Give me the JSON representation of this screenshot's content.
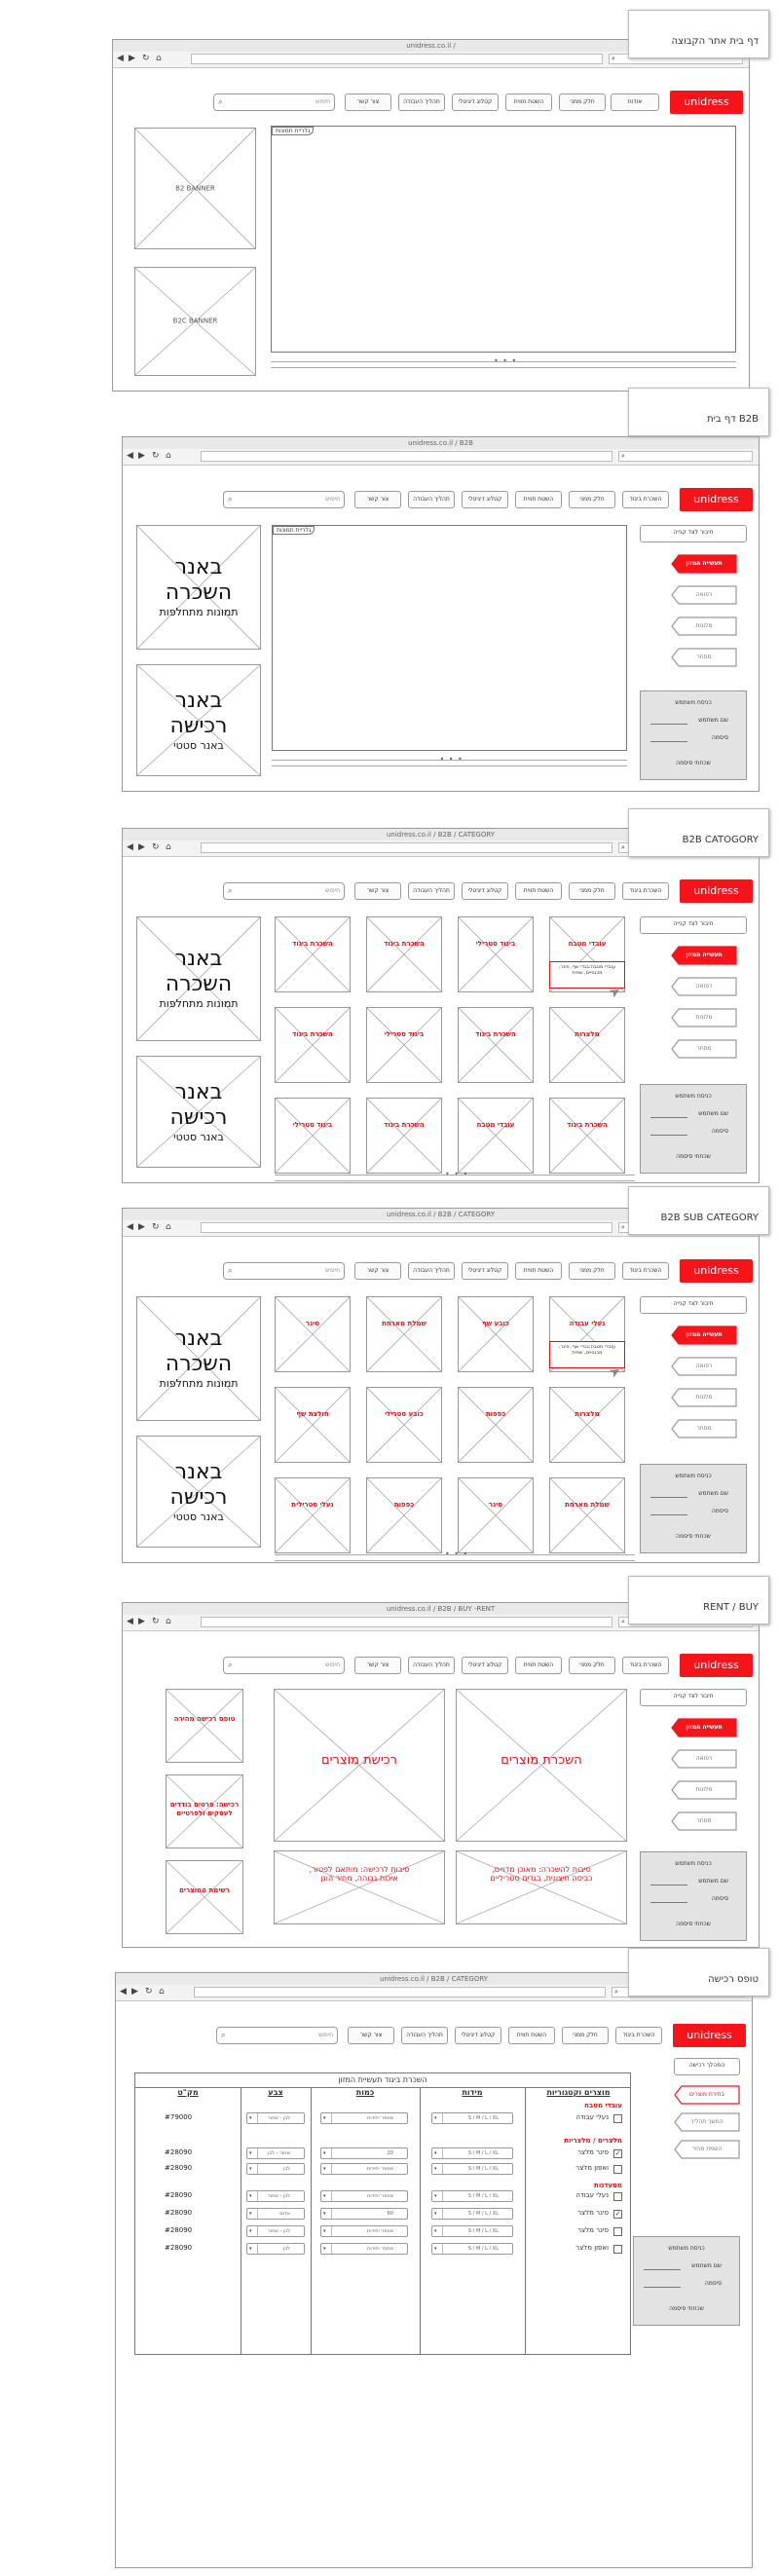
{
  "brand": {
    "logo": "unidress",
    "accent": "#f5141a"
  },
  "common": {
    "menu": {
      "rental": "השכרת ביגוד",
      "about": "אודות",
      "our_clients": "חלק ממני",
      "wash_tags": "השטת תווית",
      "catalog": "קטלוג דיגיטלי",
      "process": "תהליך העבודה",
      "contact": "צור קשר"
    },
    "site_search": "חיפוש",
    "b2b_login": "חיבור לצד קנייה",
    "industries": {
      "active": "תעשייה המזון",
      "medical": "רפואה",
      "hotels": "מלונות",
      "retail": "מסחר"
    },
    "login_box": {
      "title": "כניסת משתמש",
      "username": "שם משתמש",
      "password": "סיסמה",
      "forgot": "שכחתי סיסמה"
    },
    "banner_rent": {
      "line1": "באנר",
      "line2": "השכרה",
      "line3": "תמונות מתחלפות"
    },
    "banner_buy": {
      "line1": "באנר",
      "line2": "רכישה",
      "line3": "באנר סטטי"
    }
  },
  "screens": [
    {
      "note": "דף בית אתר הקבוצה",
      "url": "unidress.co.il /",
      "carousel_tag": "גלריית תמונות",
      "b2b_banner": "B2 BANNER",
      "b2c_banner": "B2C BANNER"
    },
    {
      "note": "דף בית B2B",
      "url": "unidress.co.il / B2B",
      "carousel_tag": "גלריית תמונות"
    },
    {
      "note": "B2B CATOGORY",
      "url": "unidress.co.il / B2B / CATEGORY",
      "tiles": [
        "עובדי מטבח",
        "ביגוד סטרילי",
        "השכרת ביגוד",
        "השכרת ביגוד",
        "מלצרות",
        "השכרת ביגוד",
        "ביגוד סטרילי",
        "השכרת ביגוד",
        "השכרת ביגוד",
        "עובדי מטבח",
        "השכרת ביגוד",
        "ביגוד סטרילי"
      ],
      "tooltip": "עובדי מטבח:בגדי שף, סינר, מכנסיים, שפית"
    },
    {
      "note": "B2B SUB CATEGORY",
      "url": "unidress.co.il / B2B / CATEGORY",
      "tiles": [
        "נעלי עבודה",
        "כובע שף",
        "שמלת מארחת",
        "סינר",
        "מלצרות",
        "כפפות",
        "כובע סטרילי",
        "חולצת שף",
        "שמלת מארחת",
        "סינר",
        "כפפות",
        "נעלי סטרילית"
      ],
      "tooltip": "עובדי מטבח:בגדי שף, סינר, מכנסיים, שפית"
    },
    {
      "note": "RENT / BUY",
      "url": "unidress.co.il / B2B / BUY -RENT",
      "rent_tile": "השכרת מוצרים",
      "buy_tile": "רכישת מוצרים",
      "rent_info": "סיבות להשכרה: מאוכן מדויים, כביסה חיצונית, בגדים סטריליים",
      "buy_info": "סיבות לרכישה: מותאם לפטור, איכות גבוהה, מחיר הוגן",
      "side_links": [
        "טופס רכישה מהירה",
        "רכישה: פרטים בודדים לעסקים ולפרטיים",
        "רשימת המוצרים"
      ]
    },
    {
      "note": "טופס רכישה",
      "url": "unidress.co.il / B2B / CATEGORY",
      "side_buttons": [
        "המהלך רכישה",
        "בחירת מוצרים",
        "המשך תהליך",
        "השמת מחיר"
      ],
      "table_title": "השכרת ביגוד תעשיית המזון",
      "headers": {
        "products": "מוצרים וקטגוריות",
        "sizes": "מידות",
        "qty": "כמות",
        "color": "צבע",
        "sku": "מק\"ט"
      },
      "size_value": "S / M / L / XL",
      "qty_placeholder": "מספר יחידות",
      "color_white": "לבן - שחור",
      "rows": [
        {
          "cat": "עובדי מטבח",
          "product": "נעלי עבודה",
          "qty": "מספר יחידות",
          "color": "לבן - שחור",
          "sku": "#79000",
          "checked": false
        },
        {
          "cat": "מלצרים / מלצריות",
          "product": "סינר מלצר",
          "qty": "20",
          "color": "שחור - לבן",
          "sku": "#28090",
          "checked": true
        },
        {
          "product": "ואפון מלצר",
          "qty": "מספר יחידות",
          "color": "לבן",
          "sku": "#28090",
          "checked": false
        },
        {
          "cat": "מסעדנות",
          "product": "נעלי עבודה",
          "qty": "מספר יחידות",
          "color": "לבן - שחור",
          "sku": "#28090",
          "checked": false
        },
        {
          "product": "סינר מלצר",
          "qty": "60",
          "color": "אדום",
          "sku": "#28090",
          "checked": true
        },
        {
          "product": "סינר מלצר",
          "qty": "מספר יחידות",
          "color": "לבן - שחור",
          "sku": "#28090",
          "checked": false
        },
        {
          "product": "ואפון מלצר",
          "qty": "מספר יחידות",
          "color": "לבן",
          "sku": "#28090",
          "checked": false
        }
      ]
    }
  ]
}
